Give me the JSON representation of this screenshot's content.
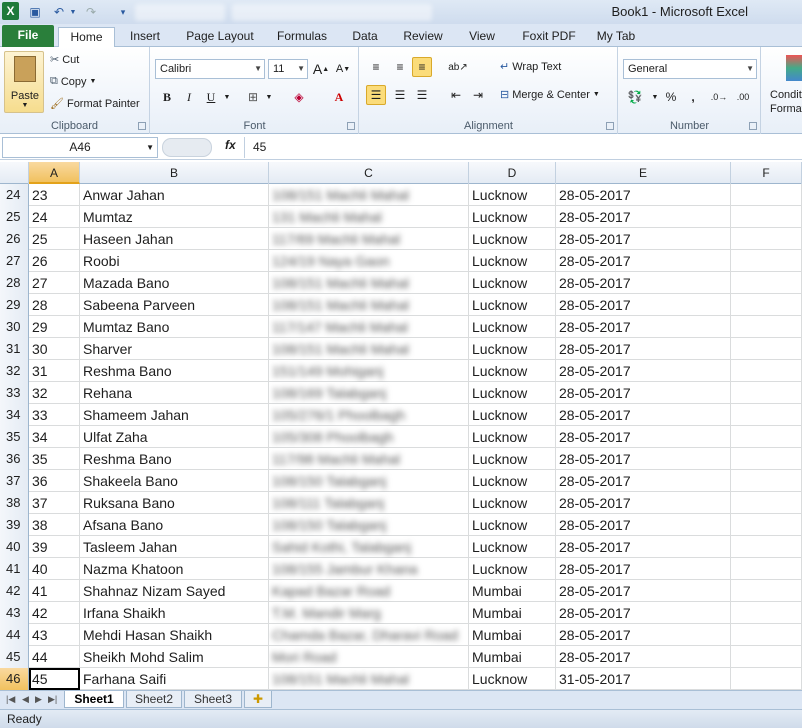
{
  "app": {
    "title": "Book1  -  Microsoft Excel"
  },
  "tabs": [
    "File",
    "Home",
    "Insert",
    "Page Layout",
    "Formulas",
    "Data",
    "Review",
    "View",
    "Foxit PDF",
    "My Tab"
  ],
  "ribbon": {
    "clipboard": {
      "paste": "Paste",
      "cut": "Cut",
      "copy": "Copy",
      "format_painter": "Format Painter",
      "label": "Clipboard"
    },
    "font": {
      "name": "Calibri",
      "size": "11",
      "bold": "B",
      "italic": "I",
      "underline": "U",
      "label": "Font"
    },
    "alignment": {
      "wrap": "Wrap Text",
      "merge": "Merge & Center",
      "label": "Alignment"
    },
    "number": {
      "format": "General",
      "percent": "%",
      "comma": ",",
      "label": "Number"
    },
    "styles": {
      "cond": "Conditi",
      "format": "Formatt"
    }
  },
  "formula_bar": {
    "name_box": "A46",
    "fx": "fx",
    "value": "45"
  },
  "columns": [
    "A",
    "B",
    "C",
    "D",
    "E",
    "F"
  ],
  "rows": [
    {
      "r": "24",
      "a": "23",
      "b": "Anwar Jahan",
      "c": "108/151 Machli Mahal",
      "d": "Lucknow",
      "e": "28-05-2017"
    },
    {
      "r": "25",
      "a": "24",
      "b": "Mumtaz",
      "c": "131 Machli Mahal",
      "d": "Lucknow",
      "e": "28-05-2017"
    },
    {
      "r": "26",
      "a": "25",
      "b": "Haseen Jahan",
      "c": "117/69 Machli Mahal",
      "d": "Lucknow",
      "e": "28-05-2017"
    },
    {
      "r": "27",
      "a": "26",
      "b": "Roobi",
      "c": "124/19 Naya Gaon",
      "d": "Lucknow",
      "e": "28-05-2017"
    },
    {
      "r": "28",
      "a": "27",
      "b": "Mazada Bano",
      "c": "108/151 Machli Mahal",
      "d": "Lucknow",
      "e": "28-05-2017"
    },
    {
      "r": "29",
      "a": "28",
      "b": "Sabeena Parveen",
      "c": "108/151 Machli Mahal",
      "d": "Lucknow",
      "e": "28-05-2017"
    },
    {
      "r": "30",
      "a": "29",
      "b": "Mumtaz Bano",
      "c": "117/147 Machli Mahal",
      "d": "Lucknow",
      "e": "28-05-2017"
    },
    {
      "r": "31",
      "a": "30",
      "b": "Sharver",
      "c": "108/151 Machli Mahal",
      "d": "Lucknow",
      "e": "28-05-2017"
    },
    {
      "r": "32",
      "a": "31",
      "b": "Reshma Bano",
      "c": "151/149 Mohiganj",
      "d": "Lucknow",
      "e": "28-05-2017"
    },
    {
      "r": "33",
      "a": "32",
      "b": "Rehana",
      "c": "108/169 Talabganj",
      "d": "Lucknow",
      "e": "28-05-2017"
    },
    {
      "r": "34",
      "a": "33",
      "b": "Shameem Jahan",
      "c": "105/276/1 Phoolbagh",
      "d": "Lucknow",
      "e": "28-05-2017"
    },
    {
      "r": "35",
      "a": "34",
      "b": "Ulfat Zaha",
      "c": "105/308 Phoolbagh",
      "d": "Lucknow",
      "e": "28-05-2017"
    },
    {
      "r": "36",
      "a": "35",
      "b": "Reshma Bano",
      "c": "117/98 Machli Mahal",
      "d": "Lucknow",
      "e": "28-05-2017"
    },
    {
      "r": "37",
      "a": "36",
      "b": "Shakeela Bano",
      "c": "108/150 Talabganj",
      "d": "Lucknow",
      "e": "28-05-2017"
    },
    {
      "r": "38",
      "a": "37",
      "b": "Ruksana Bano",
      "c": "108/111 Talabganj",
      "d": "Lucknow",
      "e": "28-05-2017"
    },
    {
      "r": "39",
      "a": "38",
      "b": "Afsana Bano",
      "c": "108/150 Talabganj",
      "d": "Lucknow",
      "e": "28-05-2017"
    },
    {
      "r": "40",
      "a": "39",
      "b": "Tasleem Jahan",
      "c": "Sahid Kothi, Talabganj",
      "d": "Lucknow",
      "e": "28-05-2017"
    },
    {
      "r": "41",
      "a": "40",
      "b": "Nazma Khatoon",
      "c": "108/155 Jambur Khana",
      "d": "Lucknow",
      "e": "28-05-2017"
    },
    {
      "r": "42",
      "a": "41",
      "b": "Shahnaz Nizam Sayed",
      "c": "Kapad Bazar Road",
      "d": "Mumbai",
      "e": "28-05-2017"
    },
    {
      "r": "43",
      "a": "42",
      "b": "Irfana Shaikh",
      "c": "T.M. Mandir Marg",
      "d": "Mumbai",
      "e": "28-05-2017"
    },
    {
      "r": "44",
      "a": "43",
      "b": "Mehdi Hasan Shaikh",
      "c": "Chamda Bazar, Dharavi Road",
      "d": "Mumbai",
      "e": "28-05-2017"
    },
    {
      "r": "45",
      "a": "44",
      "b": "Sheikh Mohd Salim",
      "c": "Mori Road",
      "d": "Mumbai",
      "e": "28-05-2017"
    },
    {
      "r": "46",
      "a": "45",
      "b": "Farhana Saifi",
      "c": "108/151 Machli Mahal",
      "d": "Lucknow",
      "e": "31-05-2017"
    }
  ],
  "sheets": [
    "Sheet1",
    "Sheet2",
    "Sheet3"
  ],
  "status": "Ready"
}
